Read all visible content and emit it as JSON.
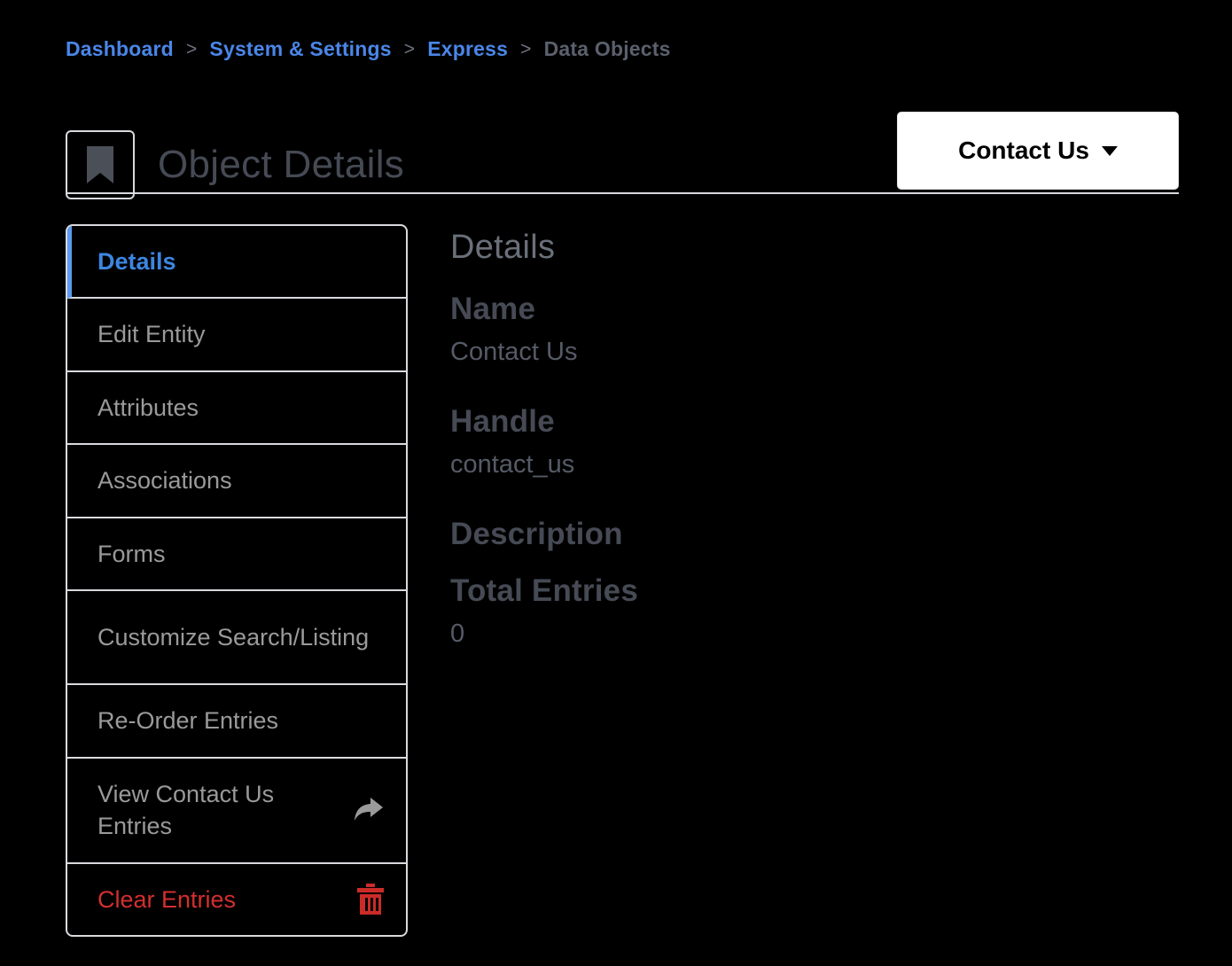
{
  "breadcrumb": {
    "separator": ">",
    "items": [
      {
        "label": "Dashboard",
        "link": true
      },
      {
        "label": "System & Settings",
        "link": true
      },
      {
        "label": "Express",
        "link": true
      },
      {
        "label": "Data Objects",
        "link": false
      }
    ]
  },
  "header": {
    "icon": "bookmark-icon",
    "title": "Object Details",
    "action_button": {
      "label": "Contact Us",
      "icon": "chevron-down-icon"
    }
  },
  "sidebar": {
    "items": [
      {
        "label": "Details",
        "state": "active",
        "icon": null
      },
      {
        "label": "Edit Entity",
        "state": "default",
        "icon": null
      },
      {
        "label": "Attributes",
        "state": "default",
        "icon": null
      },
      {
        "label": "Associations",
        "state": "default",
        "icon": null
      },
      {
        "label": "Forms",
        "state": "default",
        "icon": null
      },
      {
        "label": "Customize Search/Listing",
        "state": "default",
        "icon": null
      },
      {
        "label": "Re-Order Entries",
        "state": "default",
        "icon": null
      },
      {
        "label": "View Contact Us Entries",
        "state": "default",
        "icon": "share-arrow-icon"
      },
      {
        "label": "Clear Entries",
        "state": "danger",
        "icon": "trash-icon"
      }
    ]
  },
  "main": {
    "heading": "Details",
    "fields": [
      {
        "label": "Name",
        "value": "Contact Us"
      },
      {
        "label": "Handle",
        "value": "contact_us"
      },
      {
        "label": "Description",
        "value": ""
      },
      {
        "label": "Total Entries",
        "value": "0"
      }
    ]
  },
  "colors": {
    "background": "#000000",
    "link_blue": "#4a86e8",
    "active_blue": "#3d85e0",
    "active_border_blue": "#5b9bf0",
    "danger_red": "#d32f2f",
    "muted_gray": "#9a9a9a",
    "slate": "#454a54",
    "border_light": "#d9dade",
    "button_bg": "#ffffff"
  }
}
